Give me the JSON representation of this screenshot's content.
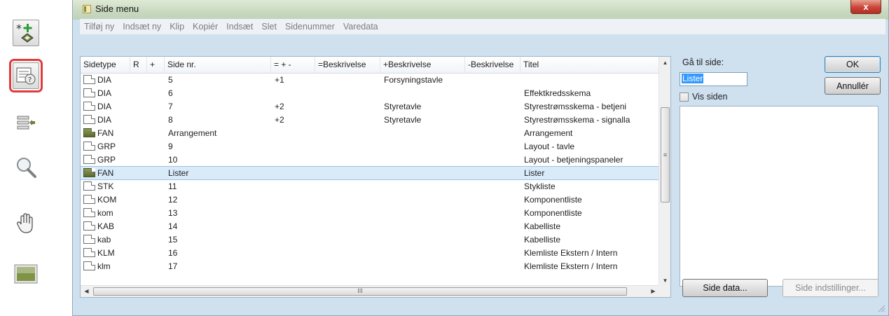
{
  "window": {
    "title": "Side menu",
    "close_glyph": "x"
  },
  "toolbar": {
    "buttons": [
      {
        "icon": "add-page-icon"
      },
      {
        "icon": "page-menu-icon",
        "selected": true
      },
      {
        "icon": "page-insert-icon"
      },
      {
        "icon": "zoom-icon"
      },
      {
        "icon": "pan-hand-icon"
      },
      {
        "icon": "image-icon"
      }
    ]
  },
  "menu": {
    "items": [
      "Tilføj ny",
      "Indsæt ny",
      "Klip",
      "Kopiér",
      "Indsæt",
      "Slet",
      "Sidenummer",
      "Varedata"
    ]
  },
  "table": {
    "headers": [
      "Sidetype",
      "R",
      "+",
      "Side nr.",
      "= + -",
      "=Beskrivelse",
      "+Beskrivelse",
      "-Beskrivelse",
      "Titel"
    ],
    "rows": [
      {
        "type": "DIA",
        "solid": false,
        "r": "",
        "plus": "",
        "page": "5",
        "eqpm": "+1",
        "eqdesc": "",
        "plusdesc": "Forsyningstavle",
        "minusdesc": "",
        "title": ""
      },
      {
        "type": "DIA",
        "solid": false,
        "r": "",
        "plus": "",
        "page": "6",
        "eqpm": "",
        "eqdesc": "",
        "plusdesc": "",
        "minusdesc": "",
        "title": "Effektkredsskema"
      },
      {
        "type": "DIA",
        "solid": false,
        "r": "",
        "plus": "",
        "page": "7",
        "eqpm": "+2",
        "eqdesc": "",
        "plusdesc": "Styretavle",
        "minusdesc": "",
        "title": "Styrestrømsskema - betjeni"
      },
      {
        "type": "DIA",
        "solid": false,
        "r": "",
        "plus": "",
        "page": "8",
        "eqpm": "+2",
        "eqdesc": "",
        "plusdesc": "Styretavle",
        "minusdesc": "",
        "title": "Styrestrømsskema - signalla"
      },
      {
        "type": "FAN",
        "solid": true,
        "r": "",
        "plus": "",
        "page": "Arrangement",
        "eqpm": "",
        "eqdesc": "",
        "plusdesc": "",
        "minusdesc": "",
        "title": "Arrangement"
      },
      {
        "type": "GRP",
        "solid": false,
        "r": "",
        "plus": "",
        "page": "9",
        "eqpm": "",
        "eqdesc": "",
        "plusdesc": "",
        "minusdesc": "",
        "title": "Layout - tavle"
      },
      {
        "type": "GRP",
        "solid": false,
        "r": "",
        "plus": "",
        "page": "10",
        "eqpm": "",
        "eqdesc": "",
        "plusdesc": "",
        "minusdesc": "",
        "title": "Layout - betjeningspaneler"
      },
      {
        "type": "FAN",
        "solid": true,
        "selected": true,
        "r": "",
        "plus": "",
        "page": "Lister",
        "eqpm": "",
        "eqdesc": "",
        "plusdesc": "",
        "minusdesc": "",
        "title": "Lister"
      },
      {
        "type": "STK",
        "solid": false,
        "r": "",
        "plus": "",
        "page": "11",
        "eqpm": "",
        "eqdesc": "",
        "plusdesc": "",
        "minusdesc": "",
        "title": "Stykliste"
      },
      {
        "type": "KOM",
        "solid": false,
        "r": "",
        "plus": "",
        "page": "12",
        "eqpm": "",
        "eqdesc": "",
        "plusdesc": "",
        "minusdesc": "",
        "title": "Komponentliste"
      },
      {
        "type": "kom",
        "solid": false,
        "r": "",
        "plus": "",
        "page": "13",
        "eqpm": "",
        "eqdesc": "",
        "plusdesc": "",
        "minusdesc": "",
        "title": "Komponentliste"
      },
      {
        "type": "KAB",
        "solid": false,
        "r": "",
        "plus": "",
        "page": "14",
        "eqpm": "",
        "eqdesc": "",
        "plusdesc": "",
        "minusdesc": "",
        "title": "Kabelliste"
      },
      {
        "type": "kab",
        "solid": false,
        "r": "",
        "plus": "",
        "page": "15",
        "eqpm": "",
        "eqdesc": "",
        "plusdesc": "",
        "minusdesc": "",
        "title": "Kabelliste"
      },
      {
        "type": "KLM",
        "solid": false,
        "r": "",
        "plus": "",
        "page": "16",
        "eqpm": "",
        "eqdesc": "",
        "plusdesc": "",
        "minusdesc": "",
        "title": "Klemliste Ekstern / Intern"
      },
      {
        "type": "klm",
        "solid": false,
        "r": "",
        "plus": "",
        "page": "17",
        "eqpm": "",
        "eqdesc": "",
        "plusdesc": "",
        "minusdesc": "",
        "title": "Klemliste Ekstern / Intern"
      }
    ],
    "vscroll_grip": "≡",
    "hscroll_grip": "III"
  },
  "side": {
    "goto_label": "Gå til side:",
    "goto_value": "Lister",
    "show_page_label": "Vis siden",
    "show_page_checked": false
  },
  "buttons": {
    "ok": "OK",
    "cancel": "Annullér",
    "page_data": "Side data...",
    "page_settings": "Side indstillinger..."
  }
}
